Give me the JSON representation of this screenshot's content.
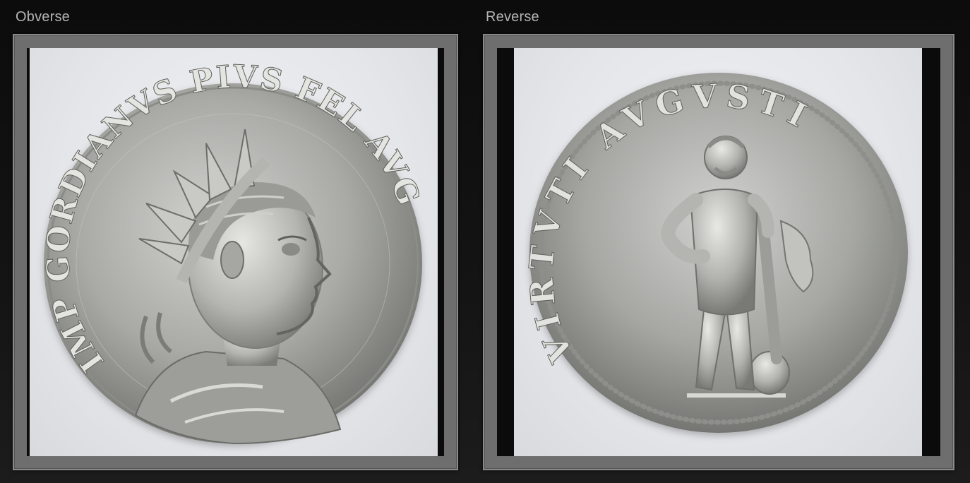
{
  "panels": {
    "obverse": {
      "caption": "Obverse",
      "legend": "IMP GORDIANVS PIVS FEL AVG"
    },
    "reverse": {
      "caption": "Reverse",
      "legend": "VIRTVTI AVGVSTI"
    }
  },
  "colors": {
    "background": "#111111",
    "frame": "#6e6e6e",
    "caption": "#b4b4b4",
    "silver_light": "#d8d8d6",
    "silver_dark": "#6f706e"
  }
}
